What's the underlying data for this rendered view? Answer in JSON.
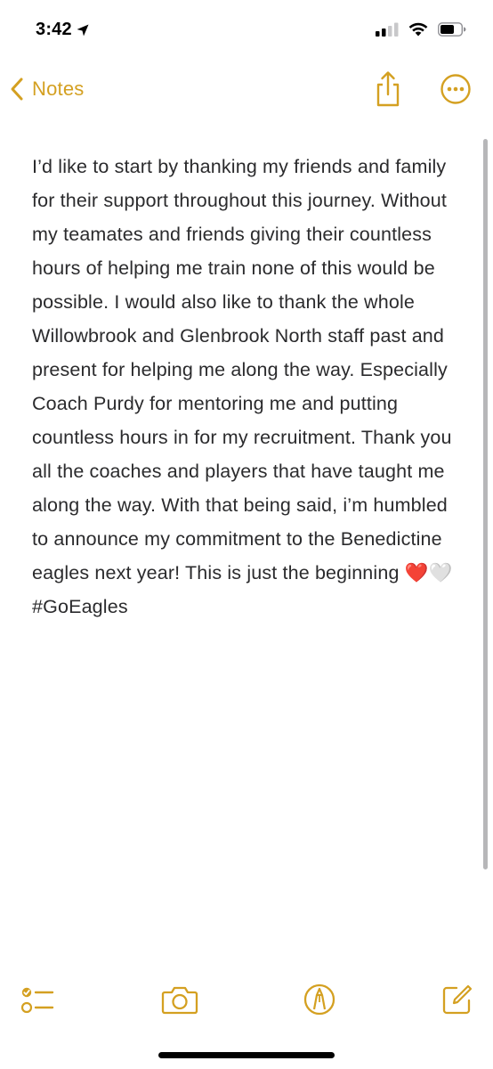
{
  "status_bar": {
    "time": "3:42",
    "icons": [
      "location-arrow-icon",
      "cellular-signal-icon",
      "wifi-icon",
      "battery-icon"
    ]
  },
  "nav": {
    "back_label": "Notes",
    "back_icon": "chevron-left-icon",
    "share_icon": "share-icon",
    "more_icon": "more-options-icon"
  },
  "note": {
    "text": "I’d like to start by thanking my friends and family for their support throughout this journey. Without my teamates and friends giving their countless hours of helping me train none of this would be possible. I would also like to thank the whole Willowbrook and Glenbrook North staff past and present for helping me along the way. Especially Coach Purdy for mentoring me and putting countless hours in for my recruitment. Thank you all the coaches and players that have taught me along the way. With that being said, i’m humbled to announce my commitment to the Benedictine eagles next year! This is just the beginning ❤️🤍 #GoEagles"
  },
  "toolbar": {
    "icons": [
      "checklist-icon",
      "camera-icon",
      "markup-pen-icon",
      "compose-icon"
    ]
  },
  "colors": {
    "accent": "#d4a021",
    "text": "#2b2b2d",
    "background": "#ffffff"
  }
}
